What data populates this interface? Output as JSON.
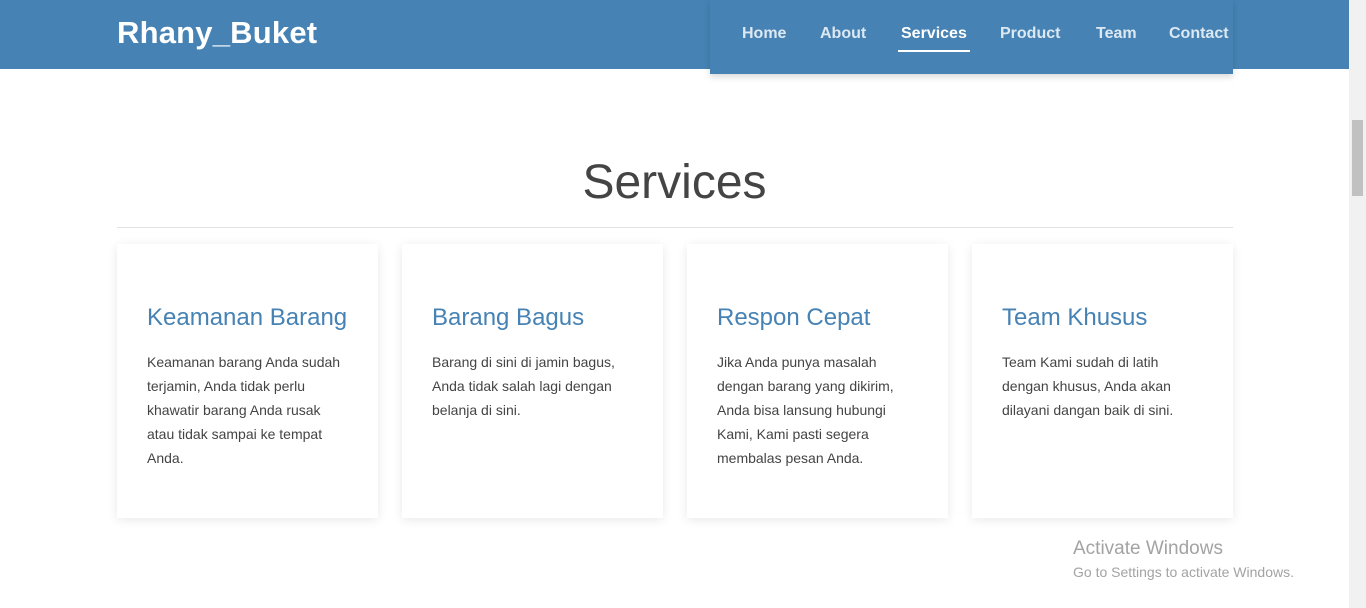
{
  "navbar": {
    "brand": "Rhany_Buket",
    "links": [
      {
        "label": "Home"
      },
      {
        "label": "About"
      },
      {
        "label": "Services"
      },
      {
        "label": "Product"
      },
      {
        "label": "Team"
      },
      {
        "label": "Contact"
      }
    ],
    "active_link": "Services",
    "color": "#4682b4"
  },
  "services": {
    "title": "Services",
    "cards": [
      {
        "title": "Keamanan Barang",
        "text": "Keamanan barang Anda sudah terjamin, Anda tidak perlu khawatir barang Anda rusak atau tidak sampai ke tempat Anda."
      },
      {
        "title": "Barang Bagus",
        "text": "Barang di sini di jamin bagus, Anda tidak salah lagi dengan belanja di sini."
      },
      {
        "title": "Respon Cepat",
        "text": "Jika Anda punya masalah dengan barang yang dikirim, Anda bisa lansung hubungi Kami, Kami pasti segera membalas pesan Anda."
      },
      {
        "title": "Team Khusus",
        "text": "Team Kami sudah di latih dengan khusus, Anda akan dilayani dangan baik di sini."
      }
    ],
    "accent_color": "#4682b4"
  },
  "watermark": {
    "title": "Activate Windows",
    "subtitle": "Go to Settings to activate Windows."
  }
}
